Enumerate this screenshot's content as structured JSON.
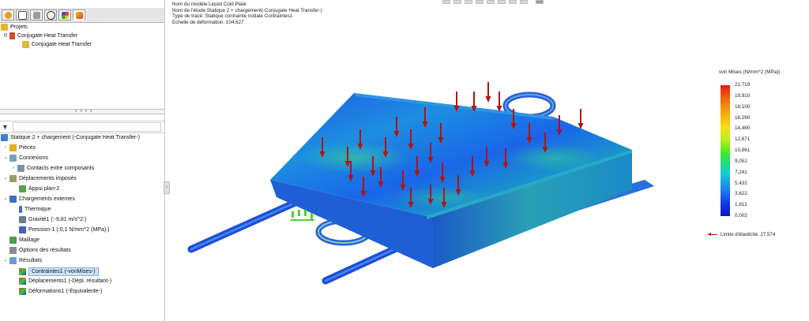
{
  "tabs": [
    "feature-manager",
    "property-manager",
    "configuration-manager",
    "dimxpert-manager",
    "display-manager",
    "simulation-manager"
  ],
  "project_tree": {
    "root_label": "Projets",
    "study_label": "Conjugate Heat Transfer",
    "child_label": "Conjugate Heat Transfer"
  },
  "splitter_grip": "• • • •",
  "sim_tree": {
    "study": "Statique 2 + chargement (-Conjugate Heat Transfer-)",
    "parts": "Pièces",
    "connections": "Connexions",
    "contacts": "Contacts entre composants",
    "fixtures": "Déplacements imposés",
    "fixture1": "Appui plan-2",
    "external_loads": "Chargements externes",
    "thermal": "Thermique",
    "gravity": "Gravité1 (:-9,81 m/s^2:)",
    "pressure": "Pression-1 (:0,1 N/mm^2 (MPa):)",
    "mesh": "Maillage",
    "result_options": "Options des résultats",
    "results": "Résultats",
    "stress": "Contraintes1 (-vonMises-)",
    "displacement": "Déplacements1 (-Dépl. résultant-)",
    "strain": "Déformations1 (-Equivalente-)"
  },
  "info": {
    "model_name": "Nom du modèle:Liquid Cold Plate",
    "study_name": "Nom de l'étude:Statique 2 + chargement(-Conjugate Heat Transfer-)",
    "plot_type": "Type de tracé: Statique contrainte nodale Contraintes1",
    "deformation_scale": "Echelle de déformation: 104,627"
  },
  "legend": {
    "title": "von Mises (N/mm^2 (MPa))",
    "ticks": [
      "21,719",
      "19,910",
      "18,100",
      "16,290",
      "14,480",
      "12,671",
      "10,861",
      "9,051",
      "7,241",
      "5,432",
      "3,622",
      "1,812",
      "0,002"
    ],
    "yield": "Limite d'élasticité: 27,574"
  },
  "colors": {
    "max": "#e31a12",
    "min": "#0a16b8",
    "load_arrow": "#b01414",
    "selection": "#cfe3fb"
  }
}
